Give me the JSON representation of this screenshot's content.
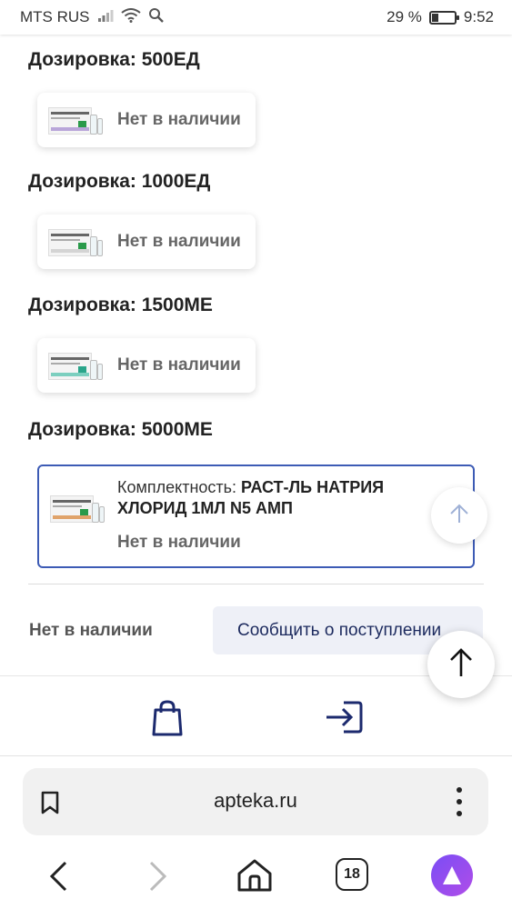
{
  "status_bar": {
    "carrier": "MTS RUS",
    "battery_percent": "29 %",
    "battery_level": 0.29,
    "time": "9:52"
  },
  "dosages": [
    {
      "title": "Дозировка: 500ЕД",
      "availability": "Нет в наличии"
    },
    {
      "title": "Дозировка: 1000ЕД",
      "availability": "Нет в наличии"
    },
    {
      "title": "Дозировка: 1500МЕ",
      "availability": "Нет в наличии"
    },
    {
      "title": "Дозировка: 5000МЕ"
    }
  ],
  "selected_variant": {
    "kit_label": "Комплектность: ",
    "kit_value": "РАСТ-ЛЬ НАТРИЯ ХЛОРИД 1МЛ N5 АМП",
    "availability": "Нет в наличии"
  },
  "purchase": {
    "status": "Нет в наличии",
    "notify_button": "Сообщить о поступлении"
  },
  "browser": {
    "url": "apteka.ru",
    "tab_count": "18"
  },
  "colors": {
    "accent": "#3d5bb5",
    "nav_icons": "#1c2a6e",
    "alice": "#8a4df0"
  }
}
